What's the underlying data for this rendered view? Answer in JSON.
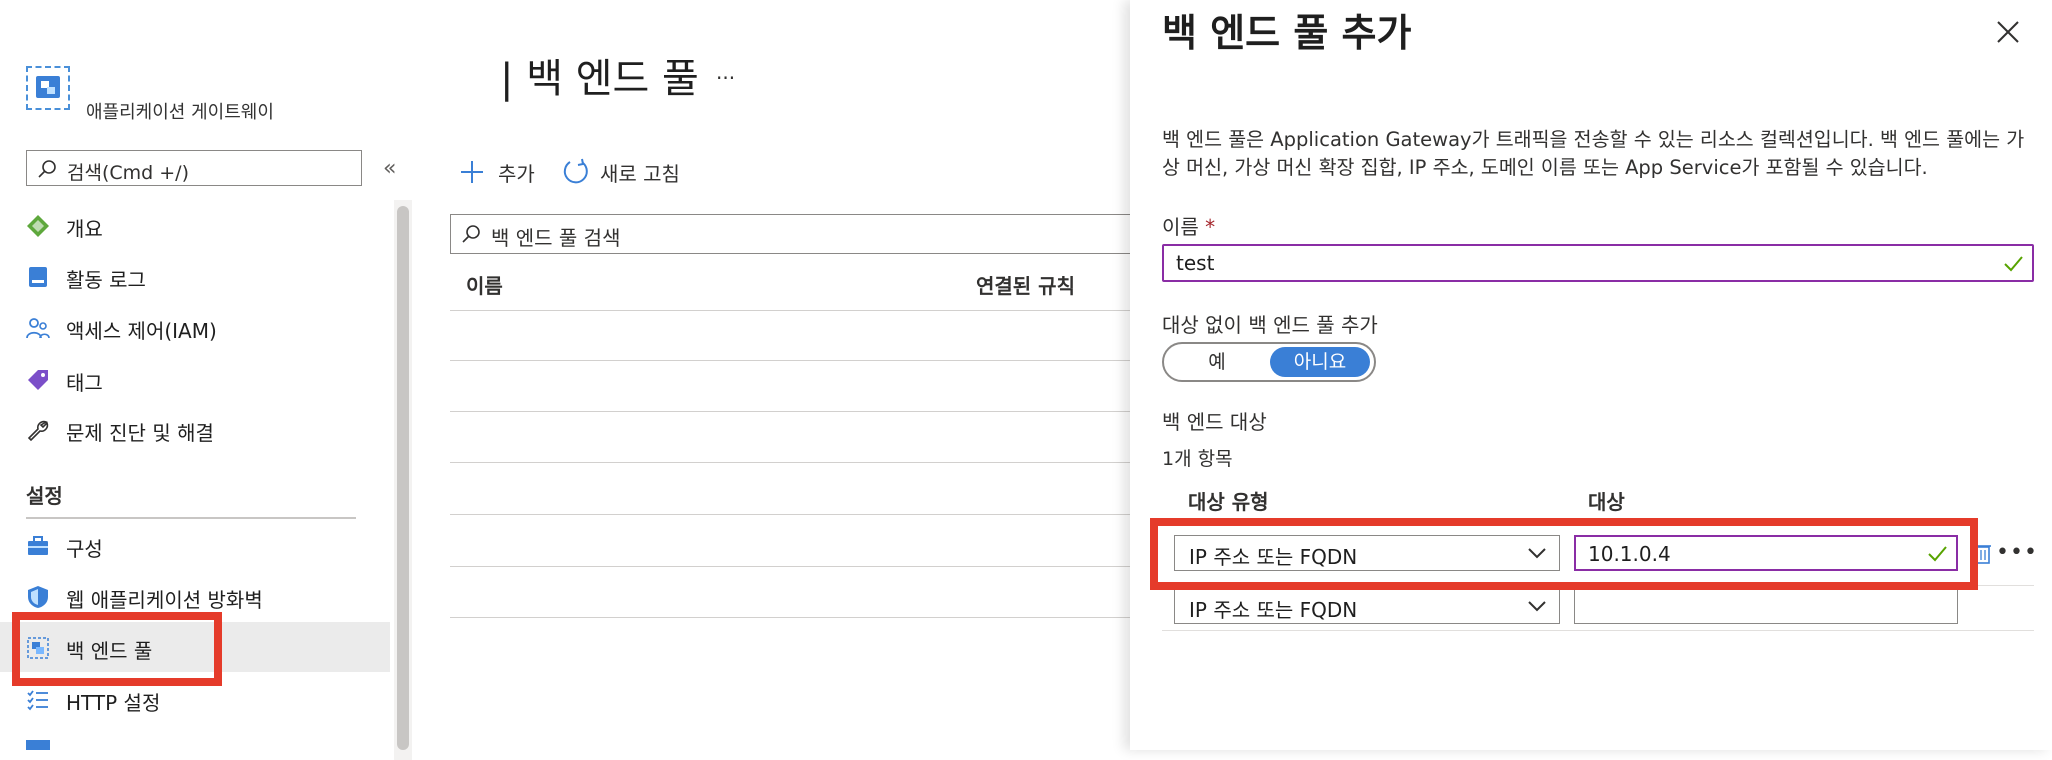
{
  "resource": {
    "name": "애플리케이션 게이트웨이"
  },
  "sidebar": {
    "search_placeholder": "검색(Cmd +/)",
    "collapse_glyph": "«",
    "items": [
      {
        "label": "개요",
        "icon": "overview-diamond-icon"
      },
      {
        "label": "활동 로그",
        "icon": "activity-log-icon"
      },
      {
        "label": "액세스 제어(IAM)",
        "icon": "people-icon"
      },
      {
        "label": "태그",
        "icon": "tag-icon"
      },
      {
        "label": "문제 진단 및 해결",
        "icon": "wrench-icon"
      }
    ],
    "section_title": "설정",
    "settings_items": [
      {
        "label": "구성",
        "icon": "toolbox-icon"
      },
      {
        "label": "웹 애플리케이션 방화벽",
        "icon": "shield-icon"
      },
      {
        "label": "백 엔드 풀",
        "icon": "backend-pool-icon",
        "selected": true
      },
      {
        "label": "HTTP 설정",
        "icon": "list-check-icon"
      }
    ]
  },
  "blade": {
    "title": "| 백 엔드 풀",
    "more": "...",
    "add_label": "추가",
    "refresh_label": "새로 고침",
    "search_placeholder": "백 엔드 풀 검색",
    "columns": [
      "이름",
      "연결된 규칙"
    ]
  },
  "panel": {
    "title": "백 엔드 풀 추가",
    "description": "백 엔드 풀은 Application Gateway가 트래픽을 전송할 수 있는 리소스 컬렉션입니다. 백 엔드 풀에는 가상 머신, 가상 머신 확장 집합, IP 주소, 도메인 이름 또는 App Service가 포함될 수 있습니다.",
    "name_label": "이름",
    "required_mark": "*",
    "name_value": "test",
    "no_target_label": "대상 없이 백 엔드 풀 추가",
    "toggle": {
      "yes": "예",
      "no": "아니요",
      "selected": "아니요"
    },
    "targets_label": "백 엔드 대상",
    "item_count": "1개 항목",
    "table_headers": {
      "type": "대상 유형",
      "target": "대상"
    },
    "rows": [
      {
        "type": "IP 주소 또는 FQDN",
        "target": "10.1.0.4"
      },
      {
        "type": "IP 주소 또는 FQDN",
        "target": ""
      }
    ],
    "row_more": "•••"
  },
  "colors": {
    "accent": "#3a7fd6",
    "highlight": "#e53b2a",
    "valid_check": "#57a300",
    "focus_border": "#8a2da5"
  }
}
